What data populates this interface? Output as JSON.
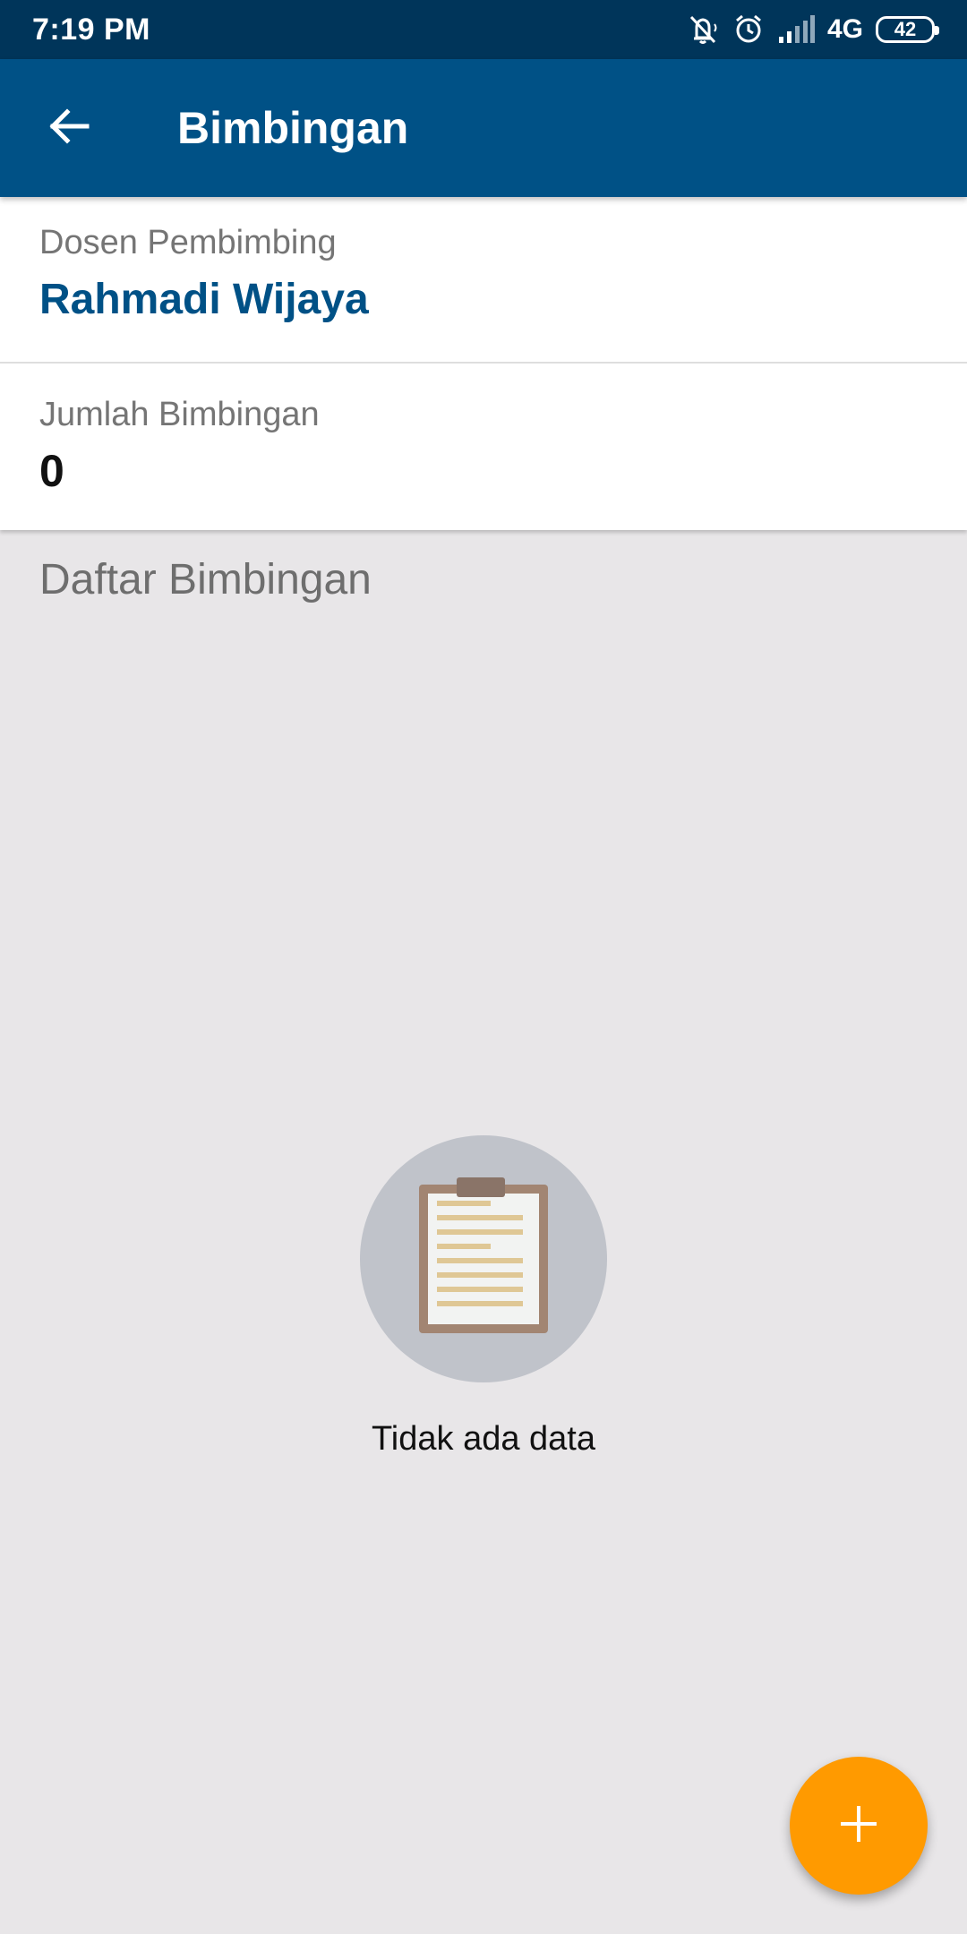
{
  "status_bar": {
    "time": "7:19 PM",
    "network": "4G",
    "battery": "42",
    "icons": [
      "bell-off-icon",
      "alarm-icon",
      "signal-icon",
      "battery-icon"
    ]
  },
  "app_bar": {
    "back_icon": "arrow-left-icon",
    "title": "Bimbingan"
  },
  "advisor": {
    "label": "Dosen Pembimbing",
    "name": "Rahmadi Wijaya"
  },
  "count": {
    "label": "Jumlah Bimbingan",
    "value": "0"
  },
  "list": {
    "title": "Daftar Bimbingan",
    "items": []
  },
  "empty_state": {
    "icon": "clipboard-icon",
    "text": "Tidak ada data"
  },
  "fab": {
    "icon": "plus-icon"
  },
  "colors": {
    "status_bar": "#00355a",
    "app_bar": "#005186",
    "accent_name": "#005186",
    "fab": "#ff9a00",
    "background": "#e8e6e8"
  }
}
